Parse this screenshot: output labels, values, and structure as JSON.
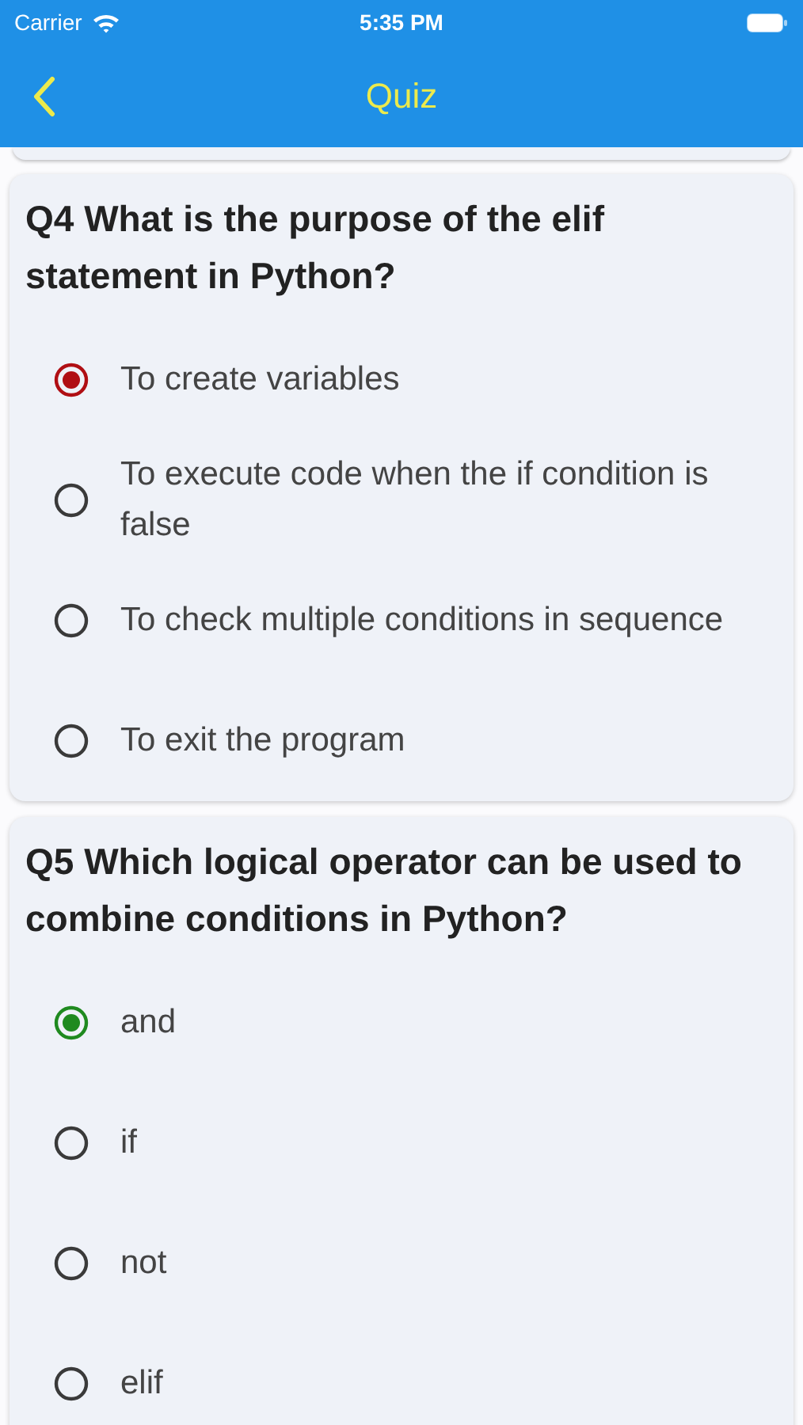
{
  "status_bar": {
    "carrier": "Carrier",
    "time": "5:35 PM"
  },
  "nav": {
    "title": "Quiz"
  },
  "questions": [
    {
      "title": "Q4 What is the purpose of the elif statement in Python?",
      "options": [
        {
          "label": "To create variables",
          "selected": true,
          "color": "#b00f14"
        },
        {
          "label": "To execute code when the if condition is false",
          "selected": false
        },
        {
          "label": "To check multiple conditions in sequence",
          "selected": false
        },
        {
          "label": "To exit the program",
          "selected": false
        }
      ]
    },
    {
      "title": "Q5 Which logical operator can be used to combine conditions in Python?",
      "options": [
        {
          "label": "and",
          "selected": true,
          "color": "#1f8a1f"
        },
        {
          "label": "if",
          "selected": false
        },
        {
          "label": "not",
          "selected": false
        },
        {
          "label": "elif",
          "selected": false
        }
      ]
    }
  ]
}
